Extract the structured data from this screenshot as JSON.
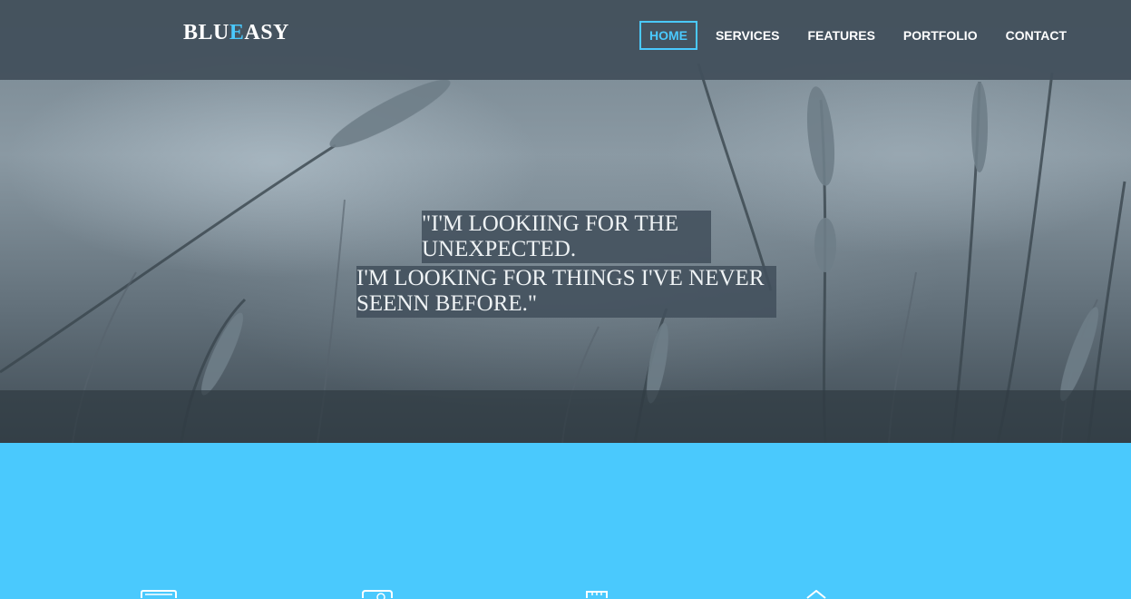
{
  "brand": {
    "prefix": "BLU",
    "accent_letter": "E",
    "suffix": "ASY"
  },
  "nav": {
    "items": [
      {
        "label": "HOME",
        "active": true
      },
      {
        "label": "SERVICES",
        "active": false
      },
      {
        "label": "FEATURES",
        "active": false
      },
      {
        "label": "PORTFOLIO",
        "active": false
      },
      {
        "label": "CONTACT",
        "active": false
      }
    ]
  },
  "hero": {
    "quote_line_1": "\"I'M LOOKIING FOR THE UNEXPECTED.",
    "quote_line_2": "I'M LOOKING FOR THINGS I'VE NEVER SEENN BEFORE.\""
  },
  "services": {
    "icons": [
      "monitor-icon",
      "camera-icon",
      "calendar-icon",
      "home-icon"
    ]
  },
  "colors": {
    "accent": "#4ac9fd",
    "navbar": "#42505c",
    "section_bg": "#4ac9fd",
    "text_light": "#ffffff"
  }
}
